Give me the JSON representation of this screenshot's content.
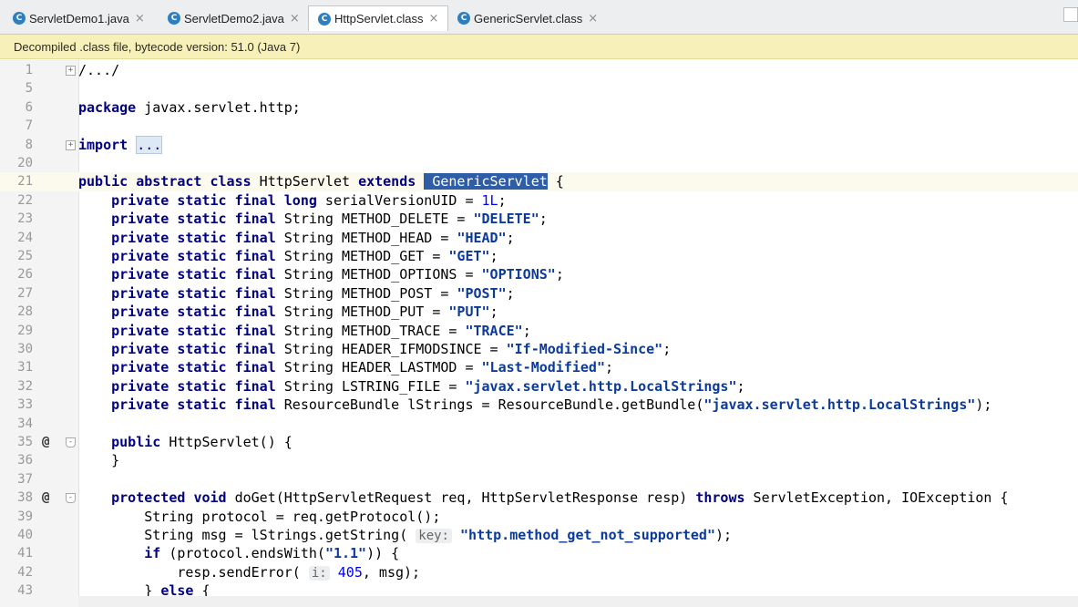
{
  "tabs": [
    {
      "label": "ServletDemo1.java",
      "icon": "class-c-icon"
    },
    {
      "label": "ServletDemo2.java",
      "icon": "class-c-icon"
    },
    {
      "label": "HttpServlet.class",
      "icon": "class-c-icon",
      "active": true
    },
    {
      "label": "GenericServlet.class",
      "icon": "class-c-icon"
    }
  ],
  "close_glyph": "×",
  "banner": "Decompiled .class file, bytecode version: 51.0 (Java 7)",
  "lines": [
    {
      "n": "1",
      "html": "<span class='fold'>+</span>",
      "t": "/.../"
    },
    {
      "n": "5",
      "t": ""
    },
    {
      "n": "6",
      "t": "package javax.servlet.http;"
    },
    {
      "n": "7",
      "t": ""
    },
    {
      "n": "8",
      "t": "import ..."
    },
    {
      "n": "20",
      "t": ""
    },
    {
      "n": "21",
      "t": "public abstract class HttpServlet extends GenericServlet {"
    },
    {
      "n": "22",
      "t": "    private static final long serialVersionUID = 1L;"
    },
    {
      "n": "23",
      "t": "    private static final String METHOD_DELETE = \"DELETE\";"
    },
    {
      "n": "24",
      "t": "    private static final String METHOD_HEAD = \"HEAD\";"
    },
    {
      "n": "25",
      "t": "    private static final String METHOD_GET = \"GET\";"
    },
    {
      "n": "26",
      "t": "    private static final String METHOD_OPTIONS = \"OPTIONS\";"
    },
    {
      "n": "27",
      "t": "    private static final String METHOD_POST = \"POST\";"
    },
    {
      "n": "28",
      "t": "    private static final String METHOD_PUT = \"PUT\";"
    },
    {
      "n": "29",
      "t": "    private static final String METHOD_TRACE = \"TRACE\";"
    },
    {
      "n": "30",
      "t": "    private static final String HEADER_IFMODSINCE = \"If-Modified-Since\";"
    },
    {
      "n": "31",
      "t": "    private static final String HEADER_LASTMOD = \"Last-Modified\";"
    },
    {
      "n": "32",
      "t": "    private static final String LSTRING_FILE = \"javax.servlet.http.LocalStrings\";"
    },
    {
      "n": "33",
      "t": "    private static final ResourceBundle lStrings = ResourceBundle.getBundle(\"javax.servlet.http.LocalStrings\");"
    },
    {
      "n": "34",
      "t": ""
    },
    {
      "n": "35",
      "t": "    public HttpServlet() {"
    },
    {
      "n": "36",
      "t": "    }"
    },
    {
      "n": "37",
      "t": ""
    },
    {
      "n": "38",
      "t": "    protected void doGet(HttpServletRequest req, HttpServletResponse resp) throws ServletException, IOException {"
    },
    {
      "n": "39",
      "t": "        String protocol = req.getProtocol();"
    },
    {
      "n": "40",
      "t": "        String msg = lStrings.getString( key: \"http.method_get_not_supported\");"
    },
    {
      "n": "41",
      "t": "        if (protocol.endsWith(\"1.1\")) {"
    },
    {
      "n": "42",
      "t": "            resp.sendError( i: 405, msg);"
    },
    {
      "n": "43",
      "t": "        } else {"
    }
  ],
  "override_marker": "@",
  "param_hint_key": "key:",
  "param_hint_i": "i:"
}
